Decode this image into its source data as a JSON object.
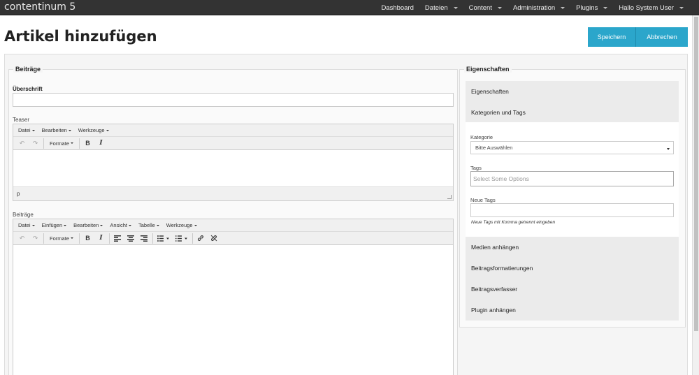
{
  "app": {
    "brand": "contentinum 5"
  },
  "nav": [
    "Dashboard",
    "Dateien",
    "Content",
    "Administration",
    "Plugins",
    "Hallo System User"
  ],
  "page": {
    "title": "Artikel hinzufügen"
  },
  "actions": {
    "save": "Speichern",
    "cancel": "Abbrechen"
  },
  "form": {
    "legend": "Beiträge",
    "heading_label": "Überschrift",
    "teaser_label": "Teaser",
    "body_label": "Beiträge",
    "teaser_menu": [
      "Datei",
      "Bearbeiten",
      "Werkzeuge"
    ],
    "teaser_formats": "Formate",
    "teaser_status": "p",
    "body_menu": [
      "Datei",
      "Einfügen",
      "Bearbeiten",
      "Ansicht",
      "Tabelle",
      "Werkzeuge"
    ],
    "body_formats": "Formate"
  },
  "properties": {
    "legend": "Eigenschaften",
    "sections": [
      "Eigenschaften",
      "Kategorien und Tags",
      "Medien anhängen",
      "Beitragsformatierungen",
      "Beitragsverfasser",
      "Plugin anhängen"
    ],
    "category_label": "Kategorie",
    "category_value": "Bitte Auswählen",
    "tags_label": "Tags",
    "tags_placeholder": "Select Some Options",
    "new_tags_label": "Neue Tags",
    "new_tags_help": "Neue Tags mit Komma getrennt eingeben"
  }
}
